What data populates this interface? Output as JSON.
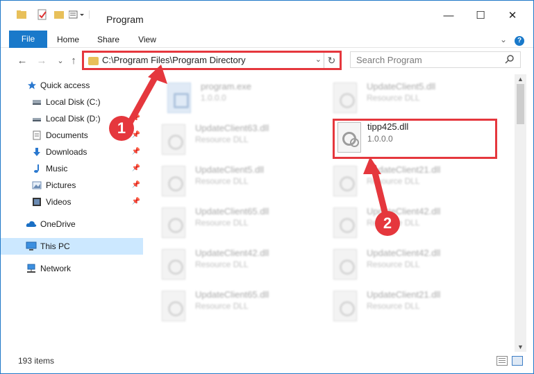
{
  "window": {
    "title": "Program",
    "controls": {
      "minimize": "—",
      "maximize": "☐",
      "close": "✕"
    }
  },
  "ribbon": {
    "tabs": [
      "File",
      "Home",
      "Share",
      "View"
    ],
    "expand": "⌄",
    "help": "?"
  },
  "nav_buttons": {
    "back": "←",
    "forward": "→",
    "recent": "⌄",
    "up": "↑"
  },
  "address": {
    "path": "C:\\Program Files\\Program Directory",
    "dropdown": "⌄",
    "refresh": "↻"
  },
  "search": {
    "placeholder": "Search Program",
    "icon": "search-icon"
  },
  "sidebar": {
    "items": [
      {
        "label": "Quick access",
        "icon": "star-icon",
        "pinned": false
      },
      {
        "label": "Local Disk (C:)",
        "icon": "drive-icon",
        "pinned": false
      },
      {
        "label": "Local Disk (D:)",
        "icon": "drive-icon",
        "pinned": true
      },
      {
        "label": "Documents",
        "icon": "documents-icon",
        "pinned": true
      },
      {
        "label": "Downloads",
        "icon": "downloads-icon",
        "pinned": true
      },
      {
        "label": "Music",
        "icon": "music-icon",
        "pinned": true
      },
      {
        "label": "Pictures",
        "icon": "pictures-icon",
        "pinned": true
      },
      {
        "label": "Videos",
        "icon": "videos-icon",
        "pinned": true
      },
      {
        "label": "OneDrive",
        "icon": "cloud-icon",
        "pinned": false
      },
      {
        "label": "This PC",
        "icon": "computer-icon",
        "pinned": false,
        "selected": true
      },
      {
        "label": "Network",
        "icon": "network-icon",
        "pinned": false
      }
    ]
  },
  "files": {
    "left_column": [
      {
        "name": "program.exe",
        "desc": "1.0.0.0"
      },
      {
        "name": "UpdateClient63.dll",
        "desc": "Resource DLL"
      },
      {
        "name": "UpdateClient5.dll",
        "desc": "Resource DLL"
      },
      {
        "name": "UpdateClient65.dll",
        "desc": "Resource DLL"
      },
      {
        "name": "UpdateClient42.dll",
        "desc": "Resource DLL"
      },
      {
        "name": "UpdateClient65.dll",
        "desc": "Resource DLL"
      }
    ],
    "right_column": [
      {
        "name": "UpdateClient5.dll",
        "desc": "Resource DLL"
      },
      {
        "name": "UpdateClient21.dll",
        "desc": "Resource DLL"
      },
      {
        "name": "UpdateClient42.dll",
        "desc": "Resource DLL"
      },
      {
        "name": "UpdateClient42.dll",
        "desc": "Resource DLL"
      },
      {
        "name": "UpdateClient21.dll",
        "desc": "Resource DLL"
      }
    ],
    "highlighted": {
      "name": "tipp425.dll",
      "version": "1.0.0.0"
    }
  },
  "status": {
    "item_count": "193 items"
  },
  "callouts": {
    "one": "1",
    "two": "2"
  },
  "colors": {
    "accent": "#1979ca",
    "annotation": "#e5373d",
    "selection": "#cce8ff"
  }
}
